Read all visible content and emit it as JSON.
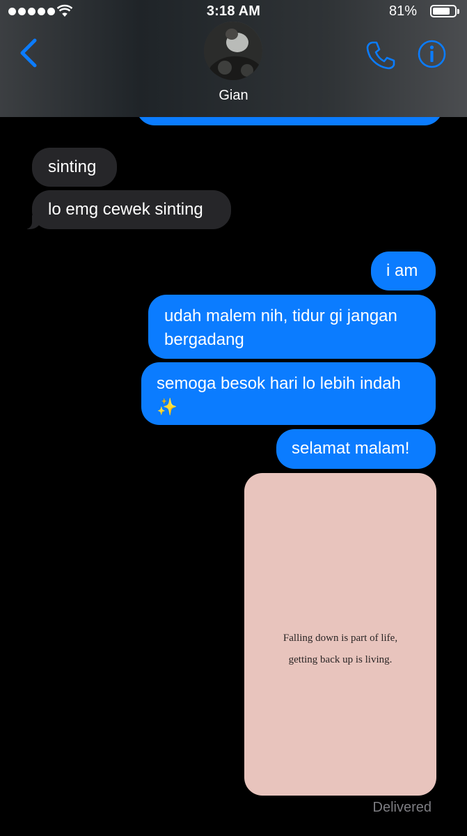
{
  "status_bar": {
    "time": "3:18 AM",
    "battery_percent": "81%",
    "battery_level": 0.81
  },
  "header": {
    "contact_name": "Gian",
    "accent_color": "#0b7cff"
  },
  "messages": [
    {
      "from": "contact",
      "text": "sinting"
    },
    {
      "from": "contact",
      "text": "lo emg cewek sinting"
    },
    {
      "from": "me",
      "text": "i am"
    },
    {
      "from": "me",
      "text": "udah malem nih, tidur gi jangan bergadang"
    },
    {
      "from": "me",
      "text": "semoga besok hari lo lebih indah ✨"
    },
    {
      "from": "me",
      "text": "selamat malam!"
    }
  ],
  "image_message": {
    "line1": "Falling down is part of life,",
    "line2": "getting back up is living.",
    "background": "#e8c4bd"
  },
  "delivery_status": "Delivered",
  "colors": {
    "sent_bubble": "#0b7cff",
    "received_bubble": "#262629",
    "background": "#000000"
  },
  "icons": [
    "back-chevron-icon",
    "phone-icon",
    "info-icon",
    "wifi-icon"
  ]
}
